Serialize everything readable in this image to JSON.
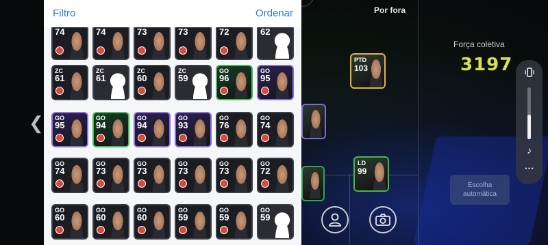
{
  "panel": {
    "filter_label": "Filtro",
    "sort_label": "Ordenar",
    "rows": [
      [
        {
          "pos": "",
          "ovr": "74",
          "face": "photo",
          "style": "normal"
        },
        {
          "pos": "",
          "ovr": "74",
          "face": "photo",
          "style": "normal"
        },
        {
          "pos": "",
          "ovr": "73",
          "face": "photo",
          "style": "normal"
        },
        {
          "pos": "",
          "ovr": "73",
          "face": "photo",
          "style": "normal"
        },
        {
          "pos": "",
          "ovr": "72",
          "face": "photo",
          "style": "normal"
        },
        {
          "pos": "",
          "ovr": "62",
          "face": "blank",
          "style": "normal"
        }
      ],
      [
        {
          "pos": "ZC",
          "ovr": "61",
          "face": "photo",
          "style": "normal"
        },
        {
          "pos": "ZC",
          "ovr": "61",
          "face": "blank",
          "style": "normal"
        },
        {
          "pos": "ZC",
          "ovr": "60",
          "face": "photo",
          "style": "normal"
        },
        {
          "pos": "ZC",
          "ovr": "59",
          "face": "blank",
          "style": "normal"
        },
        {
          "pos": "GO",
          "ovr": "96",
          "face": "photo",
          "style": "green"
        },
        {
          "pos": "GO",
          "ovr": "95",
          "face": "photo",
          "style": "purple"
        }
      ],
      [
        {
          "pos": "GO",
          "ovr": "95",
          "face": "photo",
          "style": "purple"
        },
        {
          "pos": "GO",
          "ovr": "94",
          "face": "photo",
          "style": "green"
        },
        {
          "pos": "GO",
          "ovr": "94",
          "face": "photo",
          "style": "purple"
        },
        {
          "pos": "GO",
          "ovr": "93",
          "face": "photo",
          "style": "purple"
        },
        {
          "pos": "GO",
          "ovr": "76",
          "face": "photo",
          "style": "normal"
        },
        {
          "pos": "GO",
          "ovr": "74",
          "face": "photo",
          "style": "normal"
        }
      ],
      [
        {
          "pos": "GO",
          "ovr": "74",
          "face": "photo",
          "style": "normal"
        },
        {
          "pos": "GO",
          "ovr": "73",
          "face": "photo",
          "style": "normal"
        },
        {
          "pos": "GO",
          "ovr": "73",
          "face": "photo",
          "style": "normal"
        },
        {
          "pos": "GO",
          "ovr": "73",
          "face": "photo",
          "style": "normal"
        },
        {
          "pos": "GO",
          "ovr": "73",
          "face": "photo",
          "style": "normal"
        },
        {
          "pos": "GO",
          "ovr": "72",
          "face": "photo",
          "style": "normal"
        }
      ],
      [
        {
          "pos": "GO",
          "ovr": "60",
          "face": "photo",
          "style": "normal"
        },
        {
          "pos": "GO",
          "ovr": "60",
          "face": "photo",
          "style": "normal"
        },
        {
          "pos": "GO",
          "ovr": "60",
          "face": "photo",
          "style": "normal"
        },
        {
          "pos": "GO",
          "ovr": "59",
          "face": "photo",
          "style": "normal"
        },
        {
          "pos": "GO",
          "ovr": "59",
          "face": "photo",
          "style": "normal"
        },
        {
          "pos": "GO",
          "ovr": "59",
          "face": "blank",
          "style": "normal"
        }
      ]
    ]
  },
  "field": {
    "view_label": "Por fora",
    "strength_label": "Força coletiva",
    "strength_value": "3197",
    "auto_select_label": "Escolha automática",
    "cards": [
      {
        "pos": "PTD",
        "ovr": "103"
      },
      {
        "pos": "",
        "ovr": ""
      },
      {
        "pos": "",
        "ovr": ""
      },
      {
        "pos": "LD",
        "ovr": "99"
      }
    ]
  },
  "icons": {
    "left_arrow": "chevron-left-icon",
    "person": "person-icon",
    "camera": "camera-icon",
    "vibrate": "vibrate-icon",
    "music": "music-note-icon",
    "more": "more-dots-icon"
  },
  "colors": {
    "accent": "#2f7bd8",
    "strength": "#d9e24a",
    "rare_purple": "#8a6fe0",
    "rare_green": "#3fbf52"
  }
}
